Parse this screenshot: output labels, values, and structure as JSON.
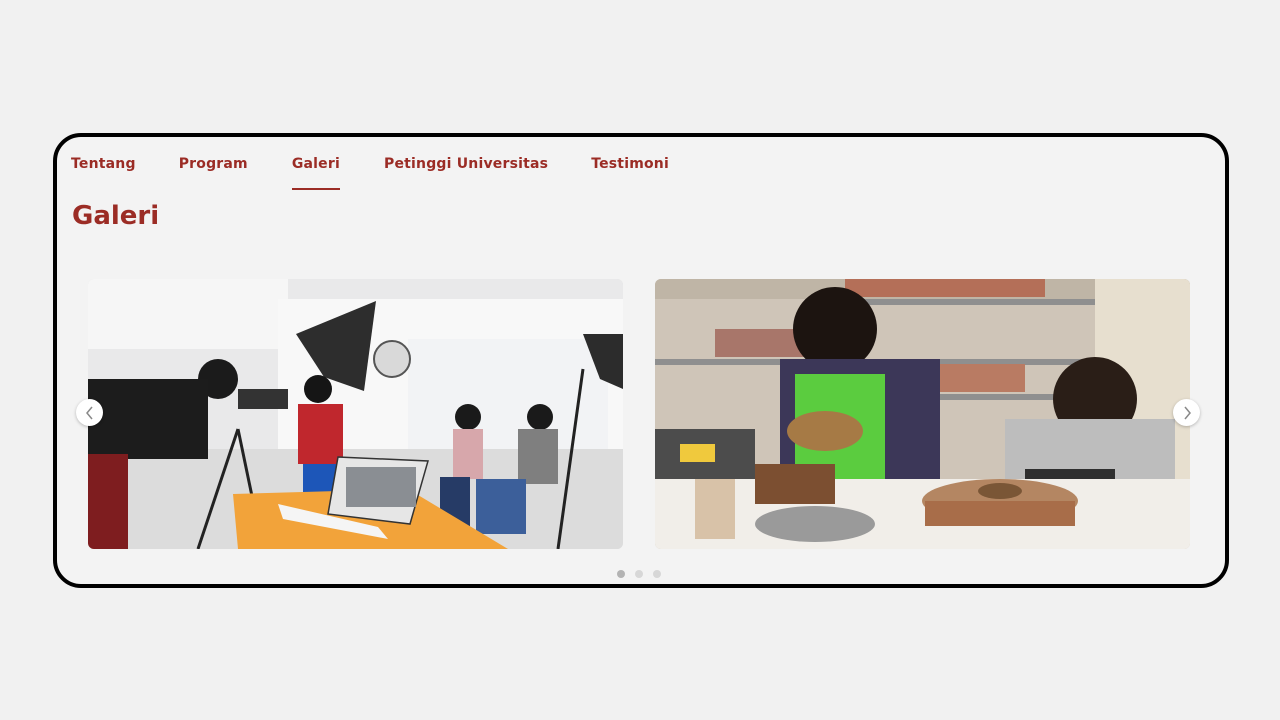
{
  "nav": {
    "tabs": [
      {
        "label": "Tentang"
      },
      {
        "label": "Program"
      },
      {
        "label": "Galeri"
      },
      {
        "label": "Petinggi Universitas"
      },
      {
        "label": "Testimoni"
      }
    ],
    "active_tab": "Galeri"
  },
  "section": {
    "title": "Galeri"
  },
  "carousel": {
    "slides": [
      {
        "alt": ""
      },
      {
        "alt": ""
      }
    ],
    "prev_icon": "chevron-left-icon",
    "next_icon": "chevron-right-icon",
    "dots": [
      true,
      false,
      false
    ]
  },
  "colors": {
    "accent": "#9b2c25",
    "frame": "#000000",
    "background": "#f1f1f1"
  }
}
